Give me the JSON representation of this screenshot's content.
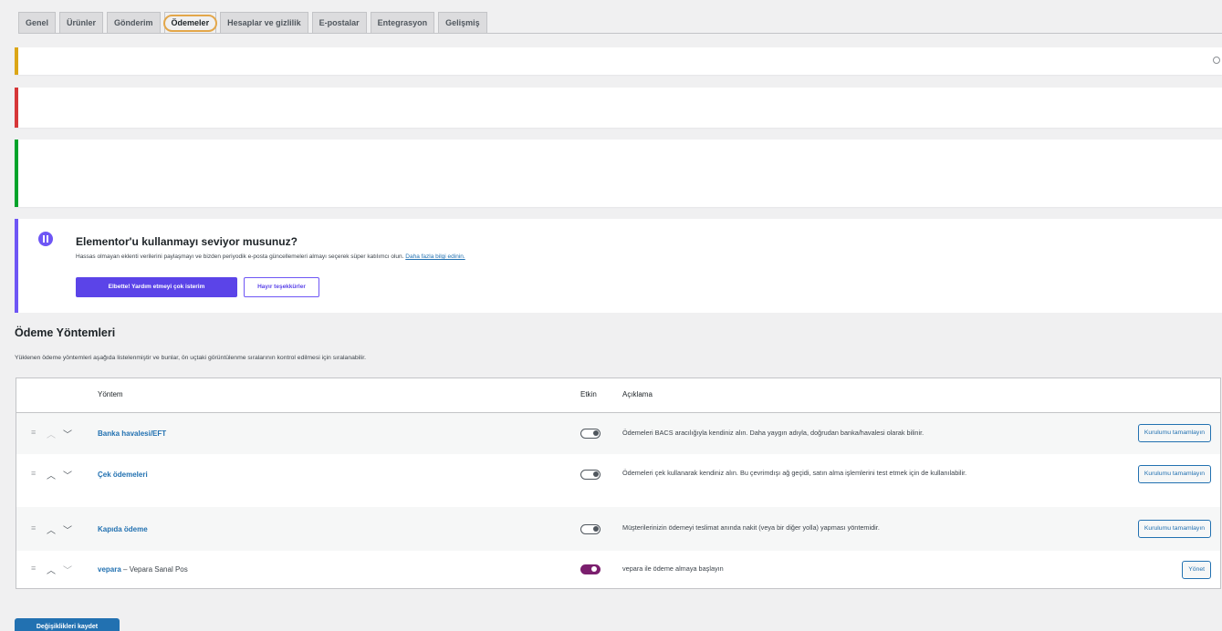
{
  "tabs": [
    {
      "label": "Genel"
    },
    {
      "label": "Ürünler"
    },
    {
      "label": "Gönderim"
    },
    {
      "label": "Ödemeler"
    },
    {
      "label": "Hesaplar ve gizlilik"
    },
    {
      "label": "E-postalar"
    },
    {
      "label": "Entegrasyon"
    },
    {
      "label": "Gelişmiş"
    }
  ],
  "colors": {
    "accent": "#2271b1",
    "elementor": "#6e56f5",
    "toggle_on": "#7b1f6e",
    "warning": "#dba617",
    "error": "#d63638",
    "success": "#00a32a"
  },
  "elementor_notice": {
    "title": "Elementor'u kullanmayı seviyor musunuz?",
    "text": "Hassas olmayan eklenti verilerini paylaşmayı ve bizden periyodik e-posta güncellemeleri almayı seçerek süper katılımcı olun.",
    "link": "Daha fazla bilgi edinin.",
    "accept_button": "Elbette! Yardım etmeyi çok isterim",
    "decline_button": "Hayır teşekkürler"
  },
  "section": {
    "title": "Ödeme Yöntemleri",
    "description": "Yüklenen ödeme yöntemleri aşağıda listelenmiştir ve bunlar, ön uçtaki görüntülenme sıralarının kontrol edilmesi için sıralanabilir."
  },
  "table": {
    "columns": {
      "method": "Yöntem",
      "enabled": "Etkin",
      "description": "Açıklama"
    },
    "rows": [
      {
        "name": "Banka havalesi/EFT",
        "subtitle": "",
        "enabled": false,
        "description": "Ödemeleri BACS aracılığıyla kendiniz alın. Daha yaygın adıyla, doğrudan banka/havalesi olarak bilinir.",
        "action": "Kurulumu tamamlayın"
      },
      {
        "name": "Çek ödemeleri",
        "subtitle": "",
        "enabled": false,
        "description": "Ödemeleri çek kullanarak kendiniz alın. Bu çevrimdışı ağ geçidi, satın alma işlemlerini test etmek için de kullanılabilir.",
        "action": "Kurulumu tamamlayın"
      },
      {
        "name": "Kapıda ödeme",
        "subtitle": "",
        "enabled": false,
        "description": "Müşterilerinizin ödemeyi teslimat anında nakit (veya bir diğer yolla) yapması yöntemidir.",
        "action": "Kurulumu tamamlayın"
      },
      {
        "name": "vepara",
        "subtitle": " – Vepara Sanal Pos",
        "enabled": true,
        "description": "vepara ile ödeme almaya başlayın",
        "action": "Yönet"
      }
    ]
  },
  "save_button": "Değişiklikleri kaydet"
}
